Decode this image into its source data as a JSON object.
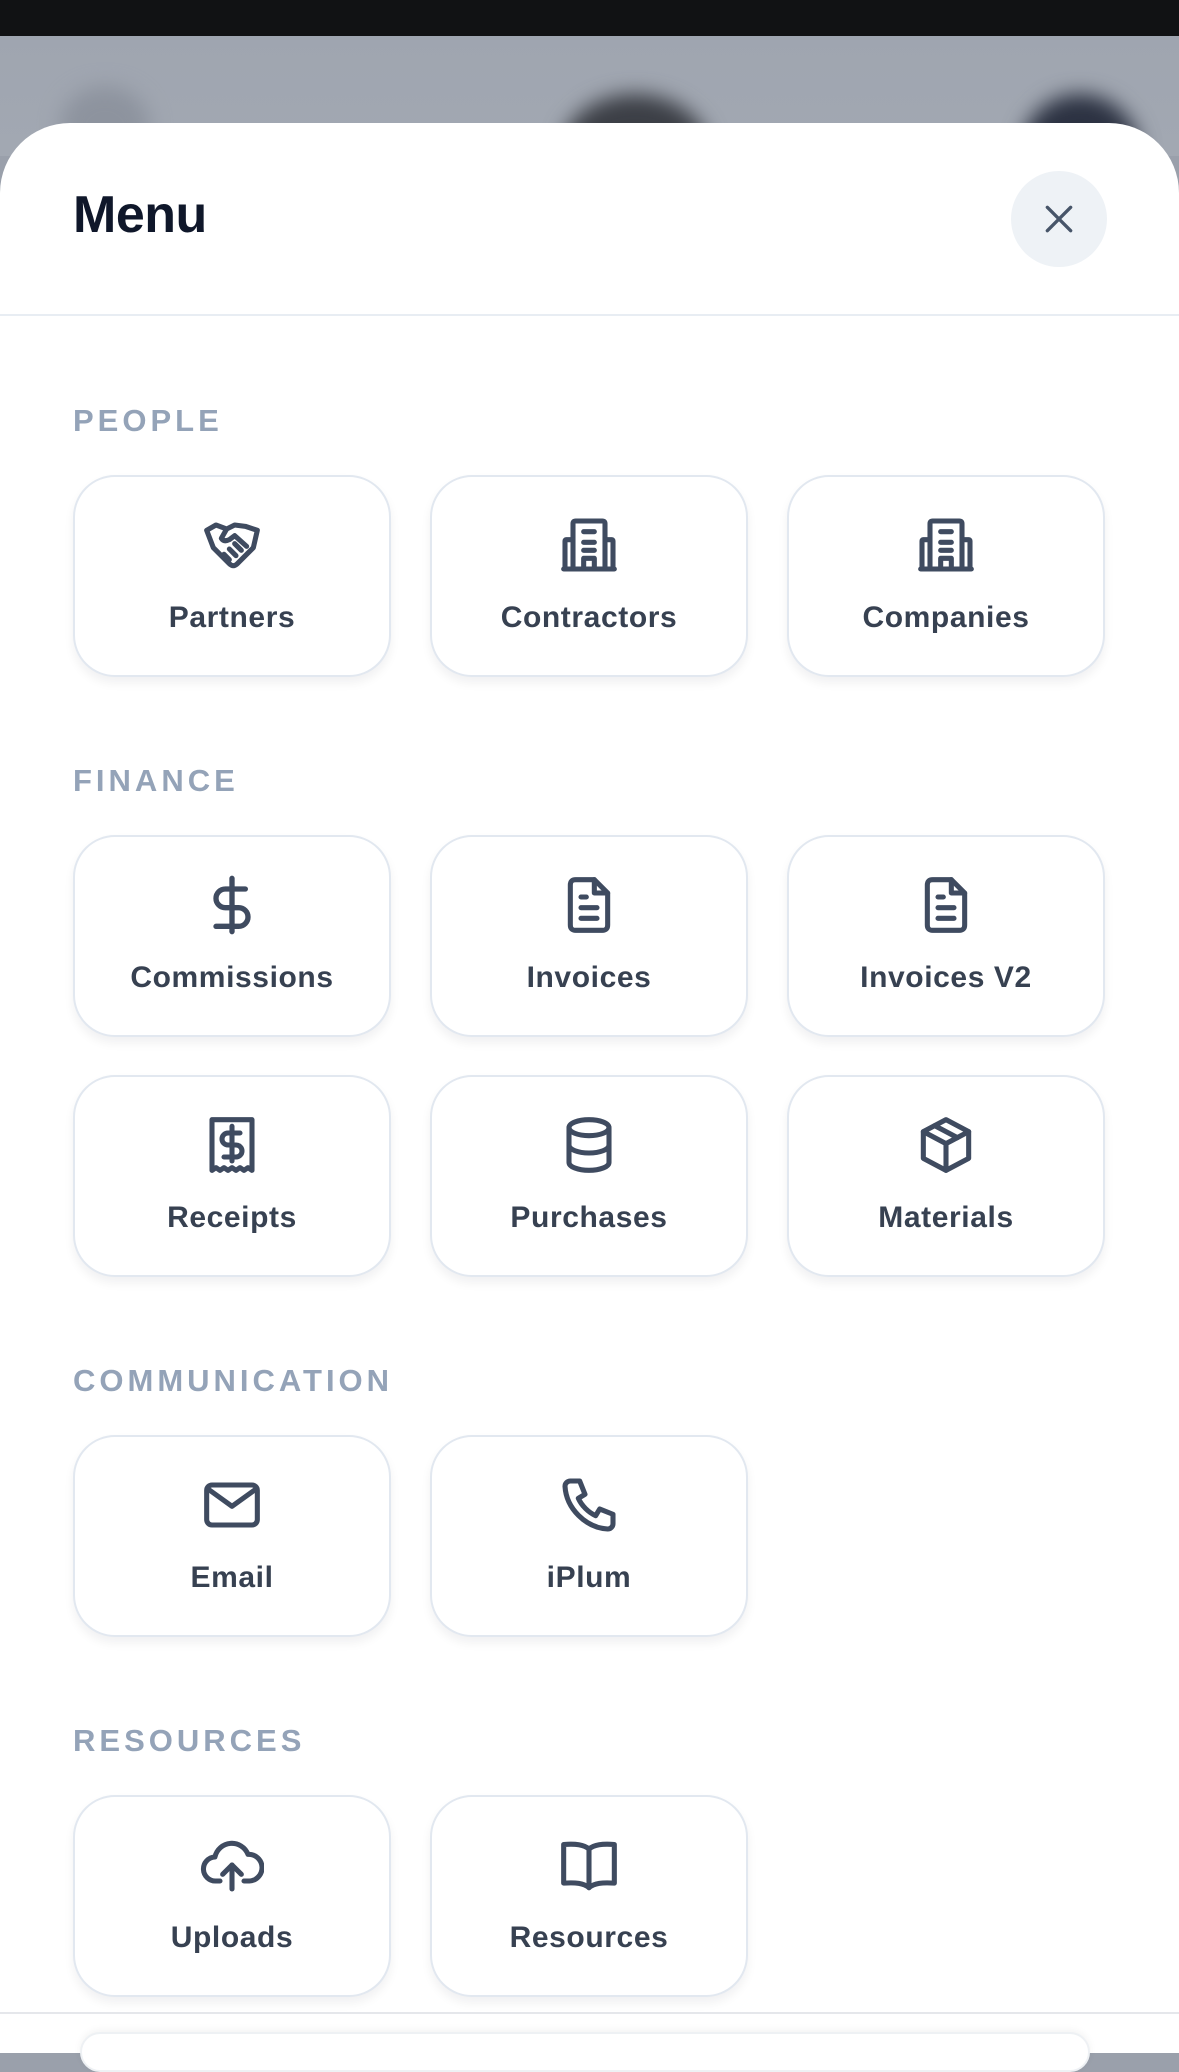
{
  "menu": {
    "title": "Menu",
    "close_icon": "close-icon"
  },
  "colors": {
    "title": "#0f172a",
    "section": "#94a3b8",
    "icon": "#3f4b60",
    "tile_border": "#e2e8f0",
    "close_bg": "#eef2f6"
  },
  "sections": {
    "people": {
      "title": "PEOPLE",
      "items": [
        {
          "label": "Partners",
          "icon": "handshake-icon"
        },
        {
          "label": "Contractors",
          "icon": "building-icon"
        },
        {
          "label": "Companies",
          "icon": "building-icon"
        }
      ]
    },
    "finance": {
      "title": "FINANCE",
      "items": [
        {
          "label": "Commissions",
          "icon": "dollar-icon"
        },
        {
          "label": "Invoices",
          "icon": "document-icon"
        },
        {
          "label": "Invoices V2",
          "icon": "document-icon"
        },
        {
          "label": "Receipts",
          "icon": "receipt-icon"
        },
        {
          "label": "Purchases",
          "icon": "database-icon"
        },
        {
          "label": "Materials",
          "icon": "box-icon"
        }
      ]
    },
    "communication": {
      "title": "COMMUNICATION",
      "items": [
        {
          "label": "Email",
          "icon": "mail-icon"
        },
        {
          "label": "iPlum",
          "icon": "phone-icon"
        }
      ]
    },
    "resources": {
      "title": "RESOURCES",
      "items": [
        {
          "label": "Uploads",
          "icon": "cloud-upload-icon"
        },
        {
          "label": "Resources",
          "icon": "book-icon"
        }
      ]
    }
  }
}
